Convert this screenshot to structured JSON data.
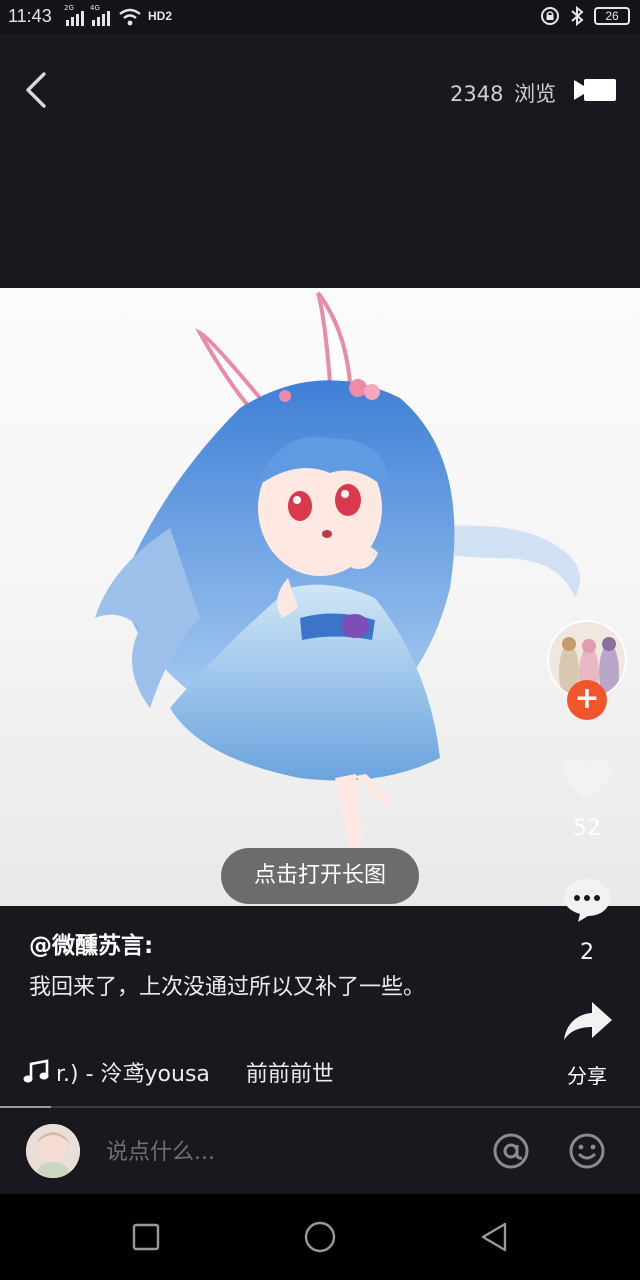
{
  "status_bar": {
    "time": "11:43",
    "signal_1_label": "2G",
    "signal_2_label": "4G",
    "network": "HD2",
    "battery": "26"
  },
  "header": {
    "views_count": "2348",
    "views_label": "浏览",
    "back_icon": "chevron-left-icon",
    "video_icon": "video-camera-icon"
  },
  "post": {
    "open_long_image_label": "点击打开长图",
    "author": "@微醺苏言:",
    "caption": "我回来了，上次没通过所以又补了一些。",
    "music_track": "r.) - 泠鸢yousa",
    "music_album": "前前前世"
  },
  "side_actions": {
    "follow_label": "+",
    "likes": "52",
    "comments": "2",
    "share_label": "分享"
  },
  "playback": {
    "progress": 0.08
  },
  "comment_bar": {
    "placeholder": "说点什么..."
  },
  "colors": {
    "background": "#18181e",
    "follow_button": "#f2552c"
  }
}
